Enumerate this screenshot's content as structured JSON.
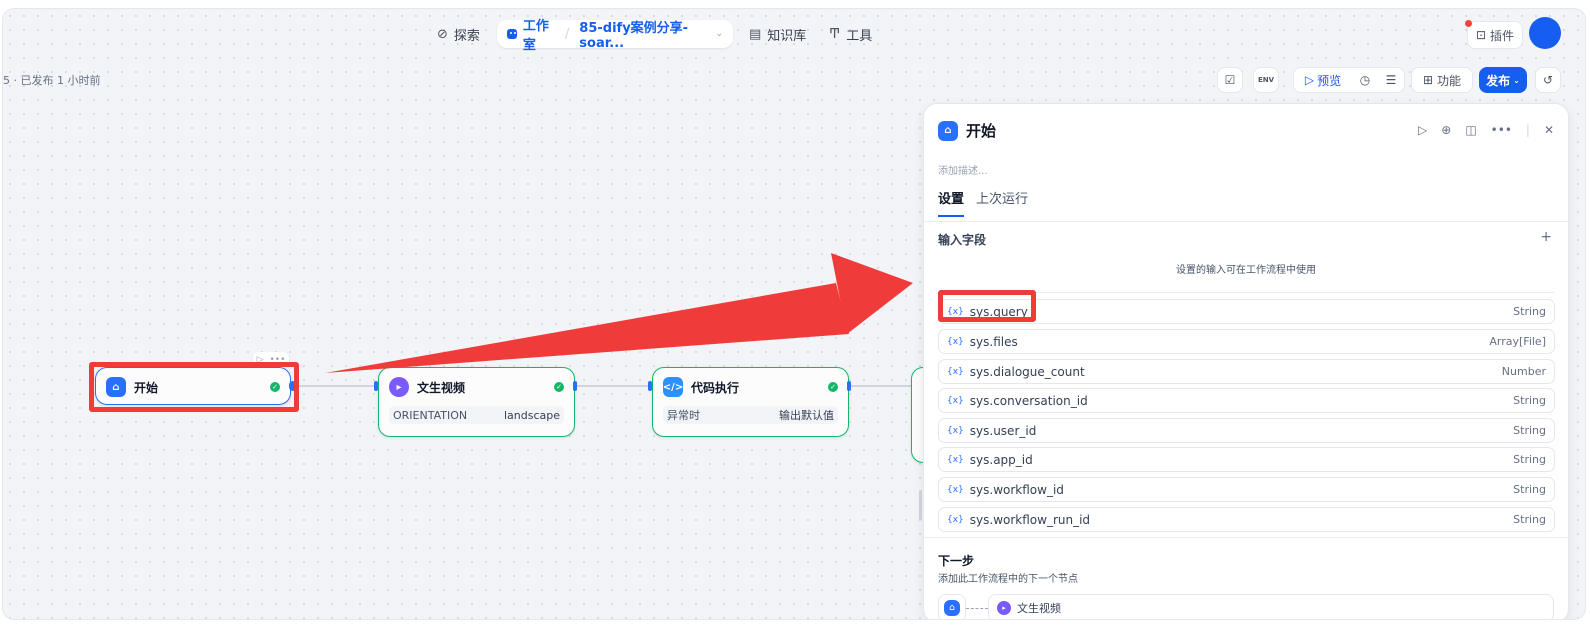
{
  "nav": {
    "explore": "探索",
    "studio": "工作室",
    "app_name": "85-dify案例分享-soar...",
    "knowledge": "知识库",
    "tools": "工具",
    "plugins": "插件"
  },
  "status": "5 · 已发布 1 小时前",
  "toolbar": {
    "env_label": "ENV",
    "preview": "预览",
    "features": "功能",
    "publish": "发布"
  },
  "nodes": {
    "start": {
      "title": "开始"
    },
    "video": {
      "title": "文生视频",
      "row_key": "ORIENTATION",
      "row_val": "landscape"
    },
    "code": {
      "title": "代码执行",
      "row_key": "异常时",
      "row_val": "输出默认值"
    }
  },
  "panel": {
    "title": "开始",
    "desc_placeholder": "添加描述...",
    "tabs": [
      {
        "label": "设置",
        "active": true
      },
      {
        "label": "上次运行",
        "active": false
      }
    ],
    "input_section": "输入字段",
    "hint": "设置的输入可在工作流程中使用",
    "variables": [
      {
        "name": "sys.query",
        "type": "String"
      },
      {
        "name": "sys.files",
        "type": "Array[File]"
      },
      {
        "name": "sys.dialogue_count",
        "type": "Number"
      },
      {
        "name": "sys.conversation_id",
        "type": "String"
      },
      {
        "name": "sys.user_id",
        "type": "String"
      },
      {
        "name": "sys.app_id",
        "type": "String"
      },
      {
        "name": "sys.workflow_id",
        "type": "String"
      },
      {
        "name": "sys.workflow_run_id",
        "type": "String"
      }
    ],
    "var_prefix": "{x}",
    "next_title": "下一步",
    "next_desc": "添加此工作流程中的下一个节点",
    "next_node": "文生视频"
  },
  "colors": {
    "accent": "#155eef",
    "success": "#12b76a",
    "annotation": "#f03b3b"
  }
}
